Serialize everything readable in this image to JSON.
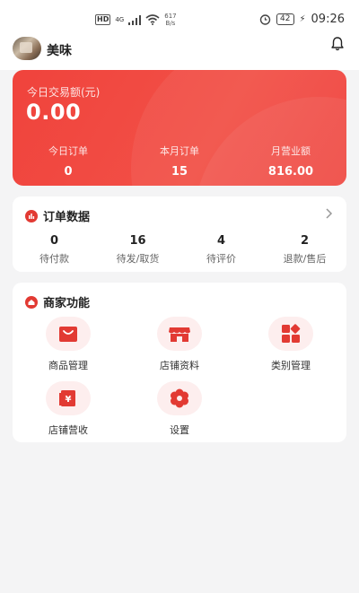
{
  "status_bar": {
    "hd_label": "HD",
    "network_label": "4G",
    "speed_value": "617",
    "speed_unit": "B/s",
    "battery": "42",
    "time": "09:26"
  },
  "header": {
    "shop_name": "美味"
  },
  "revenue": {
    "label": "今日交易额(元)",
    "value": "0.00",
    "stats": [
      {
        "label": "今日订单",
        "value": "0"
      },
      {
        "label": "本月订单",
        "value": "15"
      },
      {
        "label": "月营业额",
        "value": "816.00"
      }
    ]
  },
  "orders": {
    "title": "订单数据",
    "stats": [
      {
        "value": "0",
        "label": "待付款"
      },
      {
        "value": "16",
        "label": "待发/取货"
      },
      {
        "value": "4",
        "label": "待评价"
      },
      {
        "value": "2",
        "label": "退款/售后"
      }
    ]
  },
  "merchant": {
    "title": "商家功能",
    "items": [
      {
        "label": "商品管理",
        "icon": "shopping-bag-icon"
      },
      {
        "label": "店铺资料",
        "icon": "storefront-icon"
      },
      {
        "label": "类别管理",
        "icon": "category-grid-icon"
      },
      {
        "label": "店铺营收",
        "icon": "yuan-revenue-icon"
      },
      {
        "label": "设置",
        "icon": "settings-flower-icon"
      }
    ]
  },
  "colors": {
    "accent": "#e23a33",
    "card_red": "#f0433c",
    "icon_bg": "#fdeeee"
  }
}
